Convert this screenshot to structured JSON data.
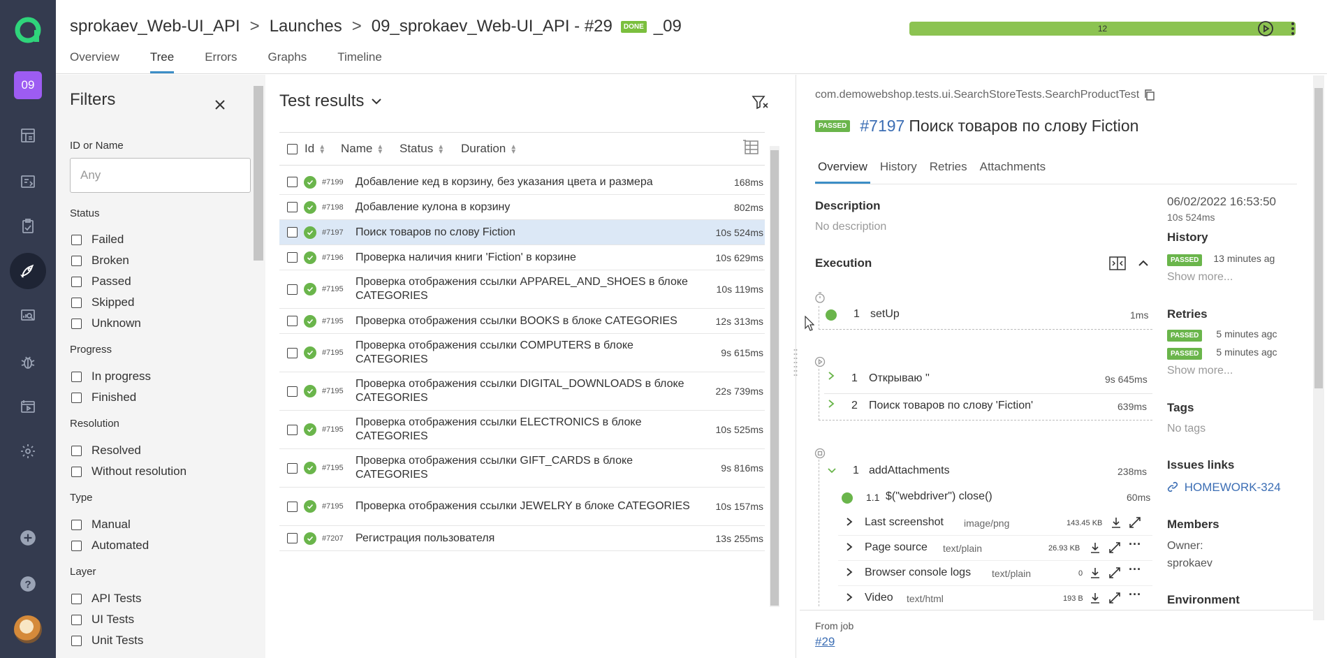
{
  "sidebar": {
    "project_badge": "09",
    "nav_icons": [
      "dashboard-icon",
      "filters-icon",
      "test-cases-icon",
      "launches-icon",
      "analytics-icon",
      "defects-icon",
      "jobs-icon",
      "settings-icon"
    ],
    "bottom_icons": [
      "add-icon",
      "help-icon"
    ]
  },
  "header": {
    "crumbs": [
      "sprokaev_Web-UI_API",
      "Launches",
      "09_sprokaev_Web-UI_API - #29"
    ],
    "status_badge": "DONE",
    "suffix": "_09",
    "progress_label": "12",
    "tabs": [
      "Overview",
      "Tree",
      "Errors",
      "Graphs",
      "Timeline"
    ],
    "active_tab": "Tree"
  },
  "filters": {
    "title": "Filters",
    "id_label": "ID or Name",
    "id_placeholder": "Any",
    "groups": [
      {
        "title": "Status",
        "options": [
          "Failed",
          "Broken",
          "Passed",
          "Skipped",
          "Unknown"
        ]
      },
      {
        "title": "Progress",
        "options": [
          "In progress",
          "Finished"
        ]
      },
      {
        "title": "Resolution",
        "options": [
          "Resolved",
          "Without resolution"
        ]
      },
      {
        "title": "Type",
        "options": [
          "Manual",
          "Automated"
        ]
      },
      {
        "title": "Layer",
        "options": [
          "API Tests",
          "UI Tests",
          "Unit Tests"
        ]
      }
    ]
  },
  "results": {
    "title": "Test results",
    "columns": [
      "Id",
      "Name",
      "Status",
      "Duration"
    ],
    "rows": [
      {
        "id": "#7199",
        "name": "Добавление кед в корзину, без указания цвета и размера",
        "duration": "168ms"
      },
      {
        "id": "#7198",
        "name": "Добавление кулона в корзину",
        "duration": "802ms"
      },
      {
        "id": "#7197",
        "name": "Поиск товаров по слову Fiction",
        "duration": "10s 524ms",
        "selected": true
      },
      {
        "id": "#7196",
        "name": "Проверка наличия книги 'Fiction' в корзине",
        "duration": "10s 629ms"
      },
      {
        "id": "#7195",
        "name": "Проверка отображения ссылки APPAREL_AND_SHOES в блоке CATEGORIES",
        "duration": "10s 119ms"
      },
      {
        "id": "#7195",
        "name": "Проверка отображения ссылки BOOKS в блоке CATEGORIES",
        "duration": "12s 313ms"
      },
      {
        "id": "#7195",
        "name": "Проверка отображения ссылки COMPUTERS в блоке CATEGORIES",
        "duration": "9s 615ms"
      },
      {
        "id": "#7195",
        "name": "Проверка отображения ссылки DIGITAL_DOWNLOADS в блоке CATEGORIES",
        "duration": "22s 739ms"
      },
      {
        "id": "#7195",
        "name": "Проверка отображения ссылки ELECTRONICS в блоке CATEGORIES",
        "duration": "10s 525ms"
      },
      {
        "id": "#7195",
        "name": "Проверка отображения ссылки GIFT_CARDS в блоке CATEGORIES",
        "duration": "9s 816ms"
      },
      {
        "id": "#7195",
        "name": "Проверка отображения ссылки JEWELRY в блоке CATEGORIES",
        "duration": "10s 157ms"
      },
      {
        "id": "#7207",
        "name": "Регистрация пользователя",
        "duration": "13s 255ms"
      }
    ]
  },
  "detail": {
    "path": "com.demowebshop.tests.ui.SearchStoreTests.SearchProductTest",
    "status": "PASSED",
    "number": "#7197",
    "title": "Поиск товаров по слову Fiction",
    "tabs": [
      "Overview",
      "History",
      "Retries",
      "Attachments"
    ],
    "description_label": "Description",
    "description_value": "No description",
    "execution_label": "Execution",
    "setup": {
      "num": "1",
      "name": "setUp",
      "duration": "1ms"
    },
    "steps": [
      {
        "num": "1",
        "name": "Открываю ''",
        "duration": "9s 645ms"
      },
      {
        "num": "2",
        "name": "Поиск товаров по слову 'Fiction'",
        "duration": "639ms"
      }
    ],
    "teardown": {
      "num": "1",
      "name": "addAttachments",
      "duration": "238ms"
    },
    "teardown_sub": {
      "num": "1.1",
      "name": "$(\"webdriver\") close()",
      "duration": "60ms"
    },
    "attachments": [
      {
        "name": "Last screenshot",
        "type": "image/png",
        "size": "143.45 KB"
      },
      {
        "name": "Page source",
        "type": "text/plain",
        "size": "26.93 KB"
      },
      {
        "name": "Browser console logs",
        "type": "text/plain",
        "size": "0"
      },
      {
        "name": "Video",
        "type": "text/html",
        "size": "193 B"
      }
    ],
    "side": {
      "date": "06/02/2022 16:53:50",
      "duration": "10s 524ms",
      "history_label": "History",
      "history_status": "PASSED",
      "history_time": "13 minutes ag",
      "show_more": "Show more...",
      "retries_label": "Retries",
      "retries": [
        {
          "status": "PASSED",
          "time": "5 minutes agc"
        },
        {
          "status": "PASSED",
          "time": "5 minutes agc"
        }
      ],
      "tags_label": "Tags",
      "tags_value": "No tags",
      "issues_label": "Issues links",
      "issue": "HOMEWORK-324",
      "members_label": "Members",
      "owner_label": "Owner:",
      "owner": "sprokaev",
      "env_label": "Environment"
    },
    "from_job_label": "From job",
    "from_job": "#29"
  },
  "colors": {
    "sidebar": "#343b4f",
    "accent": "#3c8ec6",
    "passed": "#6ab54b",
    "progress": "#8cc351"
  }
}
